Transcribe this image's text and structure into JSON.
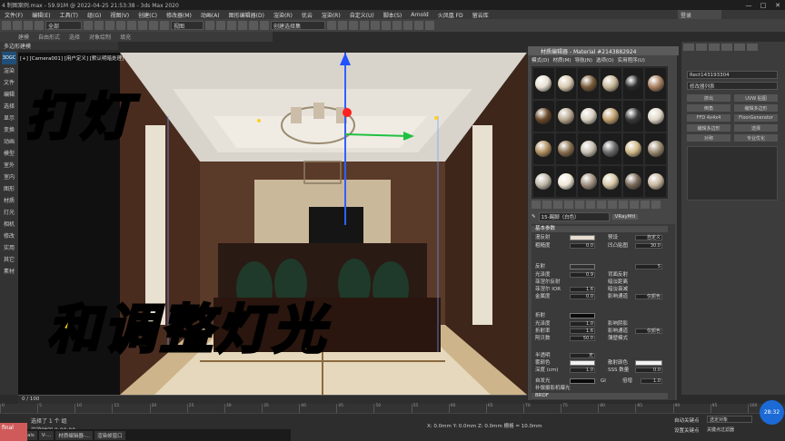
{
  "window": {
    "title": "4 制图案例.max - 59.91M @ 2022-04-25 21:53:38 - 3ds Max 2020",
    "login": "登录"
  },
  "menu": [
    "文件(F)",
    "编辑(E)",
    "工具(T)",
    "组(G)",
    "视图(V)",
    "创建(C)",
    "修改器(M)",
    "动画(A)",
    "图形编辑器(D)",
    "渲染(R)",
    "优云",
    "渲染(R)",
    "自定义(U)",
    "脚本(S)",
    "Arnold",
    "火凤凰 FD",
    "留云库"
  ],
  "toolbar": {
    "selection_filter": "全部",
    "view": "视图",
    "named_selection": "创建选择集"
  },
  "ribbon": [
    "建模",
    "自由形式",
    "选择",
    "对象绘制",
    "填充"
  ],
  "subbar": "多边形建模",
  "left_panel": {
    "logo": "3DGC",
    "items": [
      "渲染",
      "文件",
      "编辑",
      "选择",
      "显示",
      "变换",
      "动画",
      "模型",
      "室外",
      "室内",
      "图形",
      "材质",
      "灯光",
      "相机",
      "修改",
      "实用",
      "其它",
      "素材"
    ]
  },
  "viewport": {
    "label": "[+] [Camera001] [用户定义] [默认明暗处理]",
    "overlay_title": "打灯",
    "overlay_subtitle": "和调整灯光"
  },
  "material_editor": {
    "title": "材质编辑器 - Material #2143882924",
    "menu": [
      "模式(D)",
      "材质(M)",
      "导航(N)",
      "选项(O)",
      "实用程序(U)"
    ],
    "slot_colors": [
      "#e8e0d2",
      "#d9c9b0",
      "#7a5c3a",
      "#c8b89a",
      "#2a2a2a",
      "#a88060",
      "#6a4a2a",
      "#b8a890",
      "#d8d0c0",
      "#c0a070",
      "#3a3a3a",
      "#e0d8c8",
      "#b09060",
      "#8a7050",
      "#c8c0b0",
      "#6a6a6a",
      "#d0b888",
      "#9a8a70",
      "#c0b8a8",
      "#f0e8d8",
      "#a09080",
      "#d8c8a8",
      "#7a6a5a",
      "#c8b8a0"
    ],
    "material_name": "15-踢脚（白色）",
    "material_type": "VRayMtl",
    "sections": {
      "basic": "基本参数",
      "brdf": "BRDF"
    },
    "params": {
      "diffuse": "漫反射",
      "roughness": "粗糙度",
      "roughness_val": "0.0",
      "preset": "预设",
      "preset_val": "自定义",
      "sss": "凹凸贴图",
      "sss_val": "30.0",
      "reflect": "反射",
      "gloss": "光泽度",
      "gloss_val": "0.9",
      "fresnel": "菲涅尔反射",
      "fresnel_ior": "菲涅尔 IOR",
      "fresnel_ior_val": "1.6",
      "metal": "金属度",
      "metal_val": "0.0",
      "back_reflect": "背面反射",
      "dim_dist": "暗淡距离",
      "dim_falloff": "暗淡衰减",
      "affect_channel": "影响通道",
      "affect_channel_val": "仅颜色",
      "max_depth": "5",
      "refract": "折射",
      "r_gloss": "光泽度",
      "r_gloss_val": "1.0",
      "ior": "折射率",
      "ior_val": "1.6",
      "abbe": "阿贝数",
      "abbe_val": "50.0",
      "affect_shadow": "影响阴影",
      "r_affect": "影响通道",
      "r_affect_val": "仅颜色",
      "thin": "薄壁模式",
      "translucent": "半透明",
      "translucent_val": "无",
      "fog": "雾颜色",
      "fog_mult": "深度 (cm)",
      "fog_mult_val": "1.0",
      "scatter": "散射颜色",
      "scatter_amt": "SSS 数量",
      "scatter_amt_val": "0.0",
      "selfillum": "自发光",
      "gi": "GI",
      "mult": "倍增",
      "mult_val": "1.0",
      "comp": "补偿摄影机曝光",
      "brdf_type": "微面材质",
      "aniso": "各向异性",
      "aniso_val": "0.0",
      "use_gloss": "使用光泽度",
      "rot": "旋转",
      "rot_val": "0.0",
      "use_rough": "使用粗糙度",
      "local": "局部轴",
      "map_ch": "贴图通道"
    }
  },
  "right_panel": {
    "object_name": "Rect143193304",
    "modifier_list": "修改器列表",
    "buttons": [
      "挤出",
      "UVW 贴图",
      "倒角",
      "编辑多边形",
      "FFD 4x4x4",
      "FloorGenerator",
      "编辑多边形",
      "选择",
      "对称",
      "专业优化"
    ]
  },
  "trackbar": {
    "frame": "0 / 100"
  },
  "ruler": [
    "0",
    "5",
    "10",
    "15",
    "20",
    "25",
    "30",
    "35",
    "40",
    "45",
    "50",
    "55",
    "60",
    "65",
    "70",
    "75",
    "80",
    "85",
    "90",
    "95",
    "100"
  ],
  "status": {
    "selected": "选择了 1 个 组",
    "prompt": "渲染时间 0:00:00",
    "coords": "X: 0.0mm  Y: 0.0mm  Z: 0.0mm  栅格 = 10.0mm",
    "auto_key": "自动关键点",
    "set_key": "设置关键点",
    "selection": "选定对象",
    "key_filter": "关键点过滤器"
  },
  "taskbar": [
    "finals",
    "V-...",
    "材质编辑器-...",
    "渲染帧窗口"
  ],
  "clock": "28:32",
  "pink_label": "final"
}
